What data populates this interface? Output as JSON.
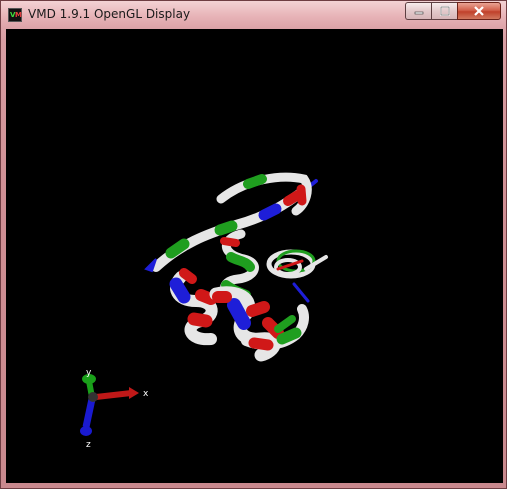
{
  "window": {
    "title": "VMD 1.9.1 OpenGL Display",
    "icon": "vmd-app-icon"
  },
  "controls": {
    "minimize_icon": "minimize-icon",
    "maximize_icon": "maximize-icon",
    "close_icon": "close-icon"
  },
  "axes": {
    "x_label": "x",
    "y_label": "y",
    "z_label": "z",
    "x_color": "#c01818",
    "y_color": "#1aa01a",
    "z_color": "#1a1ad0"
  },
  "colors": {
    "background": "#000000",
    "ribbon_white": "#e6e6e6",
    "ribbon_red": "#d01818",
    "ribbon_blue": "#1e1ed8",
    "ribbon_green": "#1f9e1f"
  }
}
